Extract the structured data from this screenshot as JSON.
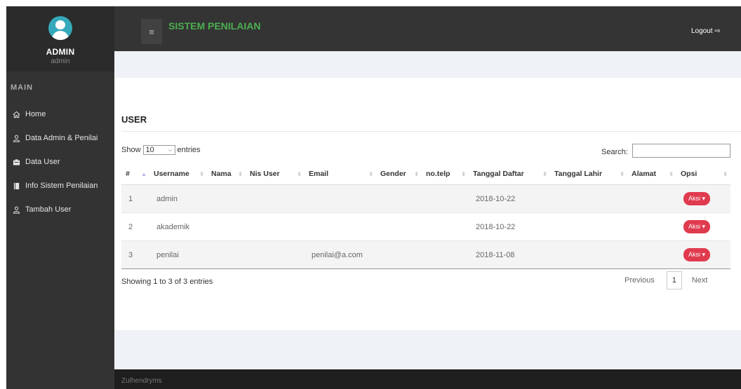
{
  "header": {
    "brand": "SISTEM PENILAIAN",
    "menu_icon": "≡",
    "logout": "Logout ⇨"
  },
  "sidebar": {
    "profile_name": "ADMIN",
    "profile_user": "admin",
    "section": "MAIN",
    "items": [
      {
        "label": "Home",
        "icon": "home-icon"
      },
      {
        "label": "Data Admin & Penilai",
        "icon": "user-icon"
      },
      {
        "label": "Data User",
        "icon": "id-card-icon"
      },
      {
        "label": "Info Sistem Penilaian",
        "icon": "book-icon"
      },
      {
        "label": "Tambah User",
        "icon": "user-icon"
      }
    ]
  },
  "main": {
    "title": "USER",
    "show_label": "Show",
    "entries_value": "10",
    "entries_label": "entries",
    "search_label": "Search:",
    "search_value": "",
    "columns": [
      "#",
      "Username",
      "Nama",
      "Nis User",
      "Email",
      "Gender",
      "no.telp",
      "Tanggal Daftar",
      "Tanggal Lahir",
      "Alamat",
      "Opsi"
    ],
    "rows": [
      {
        "no": "1",
        "username": "admin",
        "nama": "",
        "nis": "",
        "email": "",
        "gender": "",
        "telp": "",
        "daftar": "2018-10-22",
        "lahir": "",
        "alamat": "",
        "opsi": "Aksi ▾"
      },
      {
        "no": "2",
        "username": "akademik",
        "nama": "",
        "nis": "",
        "email": "",
        "gender": "",
        "telp": "",
        "daftar": "2018-10-22",
        "lahir": "",
        "alamat": "",
        "opsi": "Aksi ▾"
      },
      {
        "no": "3",
        "username": "penilai",
        "nama": "",
        "nis": "",
        "email": "penilai@a.com",
        "gender": "",
        "telp": "",
        "daftar": "2018-11-08",
        "lahir": "",
        "alamat": "",
        "opsi": "Aksi ▾"
      }
    ],
    "info": "Showing 1 to 3 of 3 entries",
    "pagination": {
      "previous": "Previous",
      "page": "1",
      "next": "Next"
    }
  },
  "footer": {
    "text": "Zulhendryms"
  },
  "colors": {
    "brand": "#4caf50",
    "sidebar": "#333333",
    "header": "#343434",
    "action": "#e03a4e"
  }
}
